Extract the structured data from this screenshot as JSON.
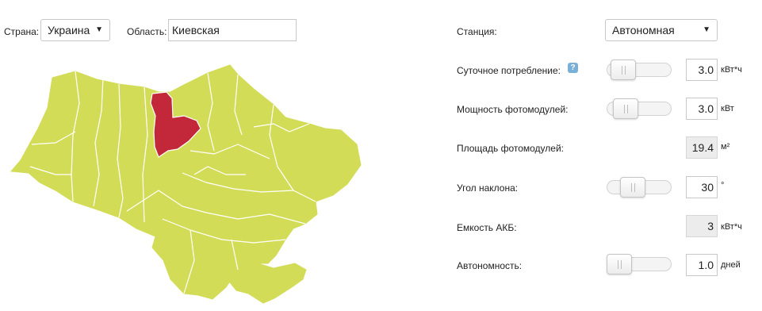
{
  "colors": {
    "region_fill": "#d3dc57",
    "region_border": "#ffffff",
    "selected_region": "#c2283a"
  },
  "location": {
    "country_label": "Страна:",
    "country_value": "Украина",
    "region_label": "Область:",
    "region_value": "Киевская"
  },
  "station": {
    "label": "Станция:",
    "value": "Автономная"
  },
  "params": [
    {
      "label": "Суточное потребление:",
      "value": "3.0",
      "unit": "кВт*ч",
      "has_slider": true,
      "slider_fraction": 0.1,
      "help_icon": "question-icon",
      "help_text": "?"
    },
    {
      "label": "Мощность фотомодулей:",
      "value": "3.0",
      "unit": "кВт",
      "has_slider": true,
      "slider_fraction": 0.15
    },
    {
      "label": "Площадь фотомодулей:",
      "value": "19.4",
      "unit": "м²",
      "has_slider": false,
      "readonly": true
    },
    {
      "label": "Угол наклона:",
      "value": "30",
      "unit": "°",
      "has_slider": true,
      "slider_fraction": 0.33
    },
    {
      "label": "Емкость АКБ:",
      "value": "3",
      "unit": "кВт*ч",
      "has_slider": false,
      "readonly": true
    },
    {
      "label": "Автономность:",
      "value": "1.0",
      "unit": "дней",
      "has_slider": true,
      "slider_fraction": 0.0
    }
  ]
}
